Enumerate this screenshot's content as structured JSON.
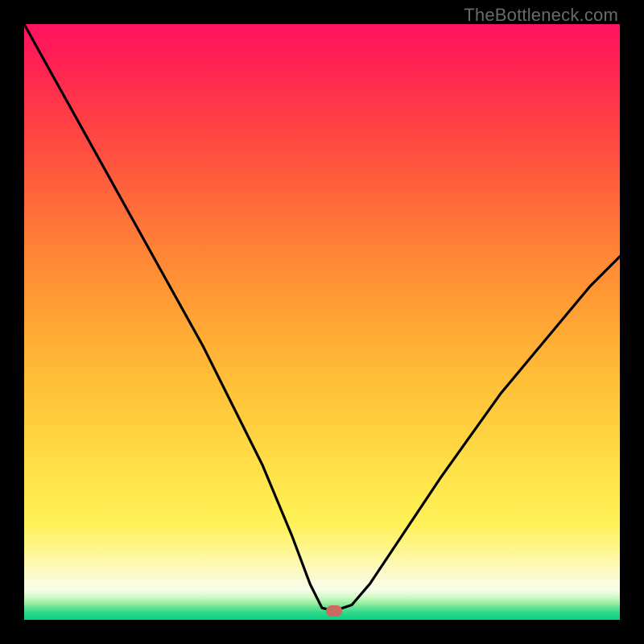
{
  "watermark": "TheBottleneck.com",
  "chart_data": {
    "type": "line",
    "title": "",
    "xlabel": "",
    "ylabel": "",
    "xlim": [
      0,
      100
    ],
    "ylim": [
      0,
      100
    ],
    "grid": false,
    "series": [
      {
        "name": "bottleneck-curve",
        "x": [
          0,
          5,
          10,
          15,
          20,
          25,
          30,
          35,
          40,
          45,
          48,
          50,
          52,
          55,
          58,
          62,
          66,
          70,
          75,
          80,
          85,
          90,
          95,
          100
        ],
        "values": [
          100,
          91,
          82,
          73,
          64,
          55,
          46,
          36,
          26,
          14,
          6,
          2,
          1.5,
          2.5,
          6,
          12,
          18,
          24,
          31,
          38,
          44,
          50,
          56,
          61
        ]
      }
    ],
    "marker": {
      "x": 52,
      "y": 1.5,
      "color": "#cc6a5f"
    },
    "gradient_stops": [
      {
        "pct": 0,
        "color": "#0ad080"
      },
      {
        "pct": 5,
        "color": "#f5fde7"
      },
      {
        "pct": 12,
        "color": "#fef68c"
      },
      {
        "pct": 33,
        "color": "#ffce3e"
      },
      {
        "pct": 61,
        "color": "#ff8636"
      },
      {
        "pct": 82,
        "color": "#ff4443"
      },
      {
        "pct": 100,
        "color": "#ff1360"
      }
    ]
  }
}
